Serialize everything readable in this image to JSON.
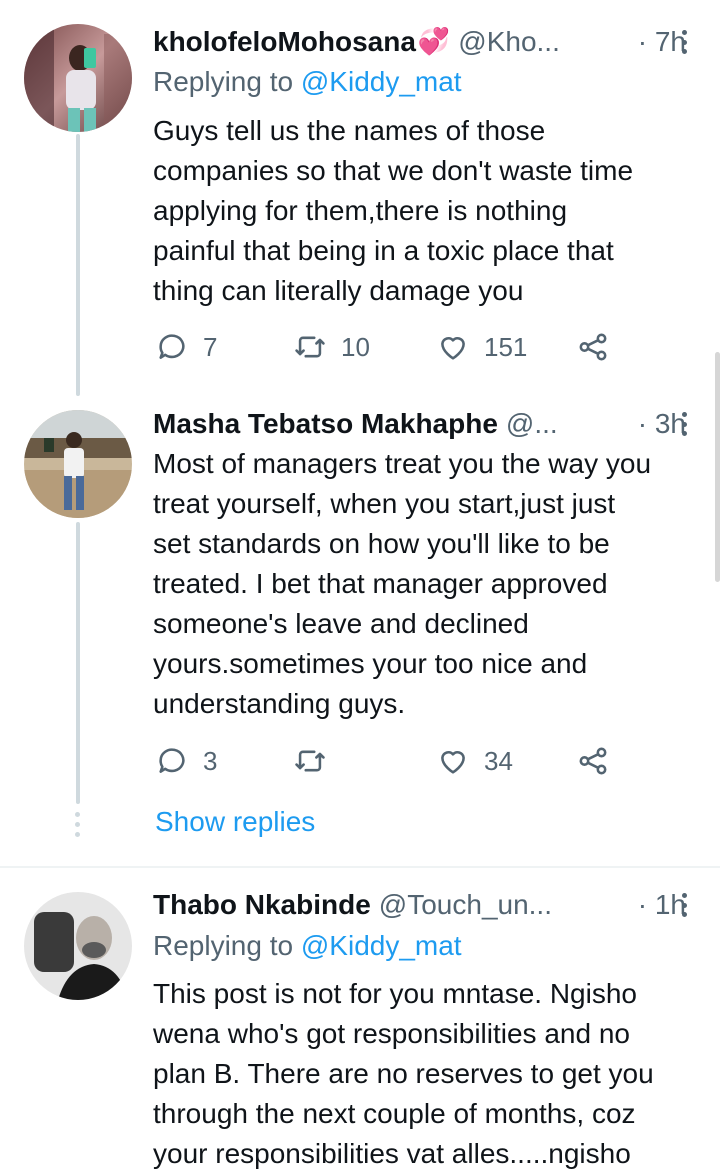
{
  "tweets": [
    {
      "name": "kholofeloMohosana",
      "emoji": "💞",
      "handle": "@Kho...",
      "time": "· 7h",
      "replying_prefix": "Replying to ",
      "replying_mention": "@Kiddy_mat",
      "text": "Guys tell us the names of those\ncompanies so that we don't waste time\napplying for them,there is nothing\npainful that being in a toxic place that\nthing can literally damage you",
      "replies": "7",
      "retweets": "10",
      "likes": "151"
    },
    {
      "name": "Masha Tebatso Makhaphe",
      "handle": "@...",
      "time": "· 3h",
      "text": "Most of managers treat you the way you\ntreat yourself, when you start,just just\nset standards on how you'll like to be\ntreated. I bet that manager approved\nsomeone's leave and declined\nyours.sometimes your too nice and\nunderstanding guys.",
      "replies": "3",
      "retweets": "",
      "likes": "34",
      "show_replies": "Show replies"
    },
    {
      "name": "Thabo Nkabinde",
      "handle": "@Touch_un...",
      "time": "· 1h",
      "replying_prefix": "Replying to ",
      "replying_mention": "@Kiddy_mat",
      "text": "This post is not for you mntase. Ngisho\nwena who's got responsibilities and no\nplan B. There are no reserves to get you\nthrough the next couple of months, coz\nyour responsibilities vat alles.....ngisho"
    }
  ],
  "icons": {
    "reply": "speech-bubble-icon",
    "retweet": "retweet-icon",
    "like": "heart-icon",
    "share": "share-icon",
    "more": "vertical-ellipsis-icon"
  },
  "colors": {
    "link": "#1d9bf0",
    "secondary": "#536471",
    "thread_line": "#cfd9de"
  }
}
